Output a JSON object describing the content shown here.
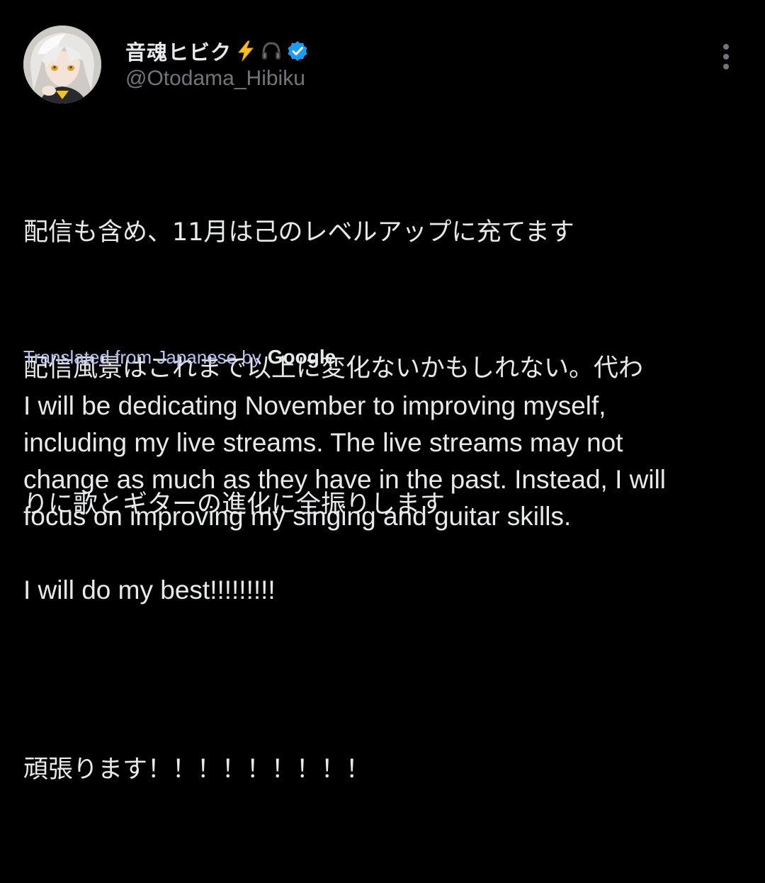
{
  "author": {
    "display_name": "音魂ヒビク",
    "emoji_1": "lightning-bolt",
    "emoji_2": "headphones",
    "verified": true,
    "handle": "@Otodama_Hibiku"
  },
  "colors": {
    "background": "#000000",
    "text": "#e7e9ea",
    "secondary_text": "#71767b",
    "translation_link": "#b8c2f0",
    "verified_badge": "#1d9bf0"
  },
  "tweet": {
    "original_lines": [
      "配信も含め、11月は己のレベルアップに充てます",
      "配信風景はこれまで以上に変化ないかもしれない。代わ",
      "りに歌とギターの進化に全振りします",
      "",
      "頑張ります！！！！！！！！！"
    ],
    "translated_from": "Translated from Japanese by",
    "translator_brand": "Google",
    "translation_lines": [
      "I will be dedicating November to improving myself,",
      "including my live streams. The live streams may not",
      "change as much as they have in the past. Instead, I will",
      "focus on improving my singing and guitar skills.",
      "",
      "I will do my best!!!!!!!!!"
    ]
  },
  "icons": {
    "more": "more-horizontal-dots-icon",
    "verified": "verified-badge-icon",
    "avatar": "avatar"
  }
}
